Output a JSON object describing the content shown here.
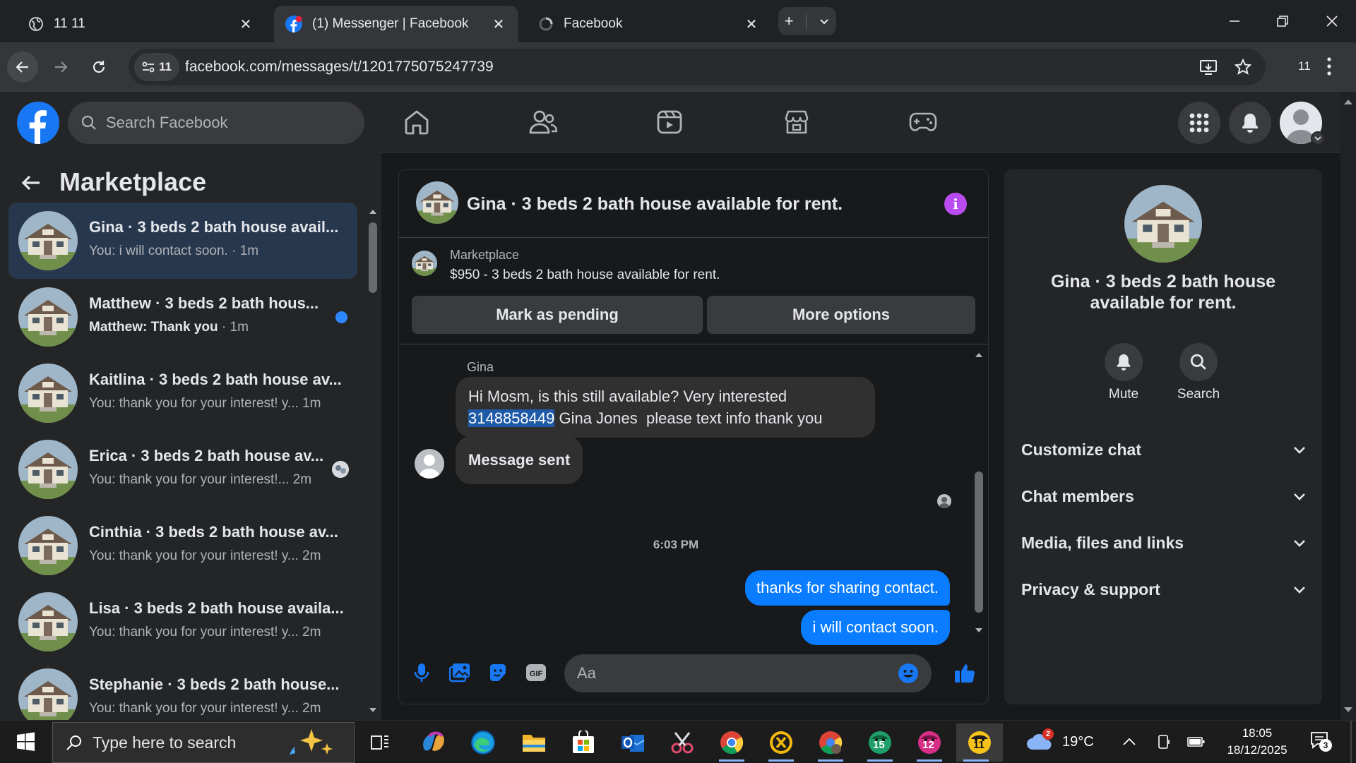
{
  "browser": {
    "tabs": [
      {
        "title": "11 11",
        "active": false
      },
      {
        "title": "(1) Messenger | Facebook",
        "active": true
      },
      {
        "title": "Facebook",
        "active": false
      }
    ],
    "url": "facebook.com/messages/t/1201775075247739",
    "site_info_count": "11",
    "profile_label": "11"
  },
  "facebook": {
    "search_placeholder": "Search Facebook"
  },
  "sidebar": {
    "title": "Marketplace",
    "conversations": [
      {
        "name": "Gina · 3 beds 2 bath house avail...",
        "preview": "You: i will contact soon.",
        "time": "1m",
        "selected": true,
        "unread": false
      },
      {
        "name": "Matthew · 3 beds 2 bath hous...",
        "preview": "Matthew: Thank you",
        "time": "1m",
        "selected": false,
        "unread": true
      },
      {
        "name": "Kaitlina · 3 beds 2 bath house av...",
        "preview": "You: thank you for your interest! y...",
        "time": "1m",
        "selected": false,
        "unread": false
      },
      {
        "name": "Erica · 3 beds 2 bath house av...",
        "preview": "You: thank you for your interest!...",
        "time": "2m",
        "selected": false,
        "unread": false
      },
      {
        "name": "Cinthia · 3 beds 2 bath house av...",
        "preview": "You: thank you for your interest! y...",
        "time": "2m",
        "selected": false,
        "unread": false
      },
      {
        "name": "Lisa · 3 beds 2 bath house availa...",
        "preview": "You: thank you for your interest! y...",
        "time": "2m",
        "selected": false,
        "unread": false
      },
      {
        "name": "Stephanie · 3 beds 2 bath house...",
        "preview": "You: thank you for your interest! y...",
        "time": "2m",
        "selected": false,
        "unread": false
      }
    ]
  },
  "chat": {
    "title": "Gina · 3 beds 2 bath house available for rent.",
    "listing": {
      "source": "Marketplace",
      "price_title": "$950 - 3 beds 2 bath house available for rent.",
      "mark_pending_label": "Mark as pending",
      "more_options_label": "More options"
    },
    "sender_name": "Gina",
    "incoming_message": {
      "line1": "Hi Mosm, is this still available? Very interested",
      "phone": "3148858449",
      "rest": " Gina Jones  please text info thank you"
    },
    "status_message": "Message sent",
    "time_separator": "6:03 PM",
    "outgoing_messages": [
      "thanks for sharing contact.",
      "i will contact soon."
    ],
    "input_placeholder": "Aa"
  },
  "details": {
    "title": "Gina · 3 beds 2 bath house available for rent.",
    "actions": [
      {
        "label": "Mute",
        "icon": "bell-icon"
      },
      {
        "label": "Search",
        "icon": "search-icon"
      }
    ],
    "sections": [
      "Customize chat",
      "Chat members",
      "Media, files and links",
      "Privacy & support"
    ]
  },
  "taskbar": {
    "search_placeholder": "Type here to search",
    "weather_temp": "19°C",
    "weather_badge": "2",
    "time": "18:05",
    "date": "18/12/2025",
    "notification_count": "3",
    "app_badges": [
      "15",
      "12",
      "11"
    ]
  },
  "colors": {
    "accent": "#0a7cff",
    "facebook_blue": "#1877f2",
    "info_purple": "#b84cf0",
    "highlight": "#1e5aa8"
  }
}
